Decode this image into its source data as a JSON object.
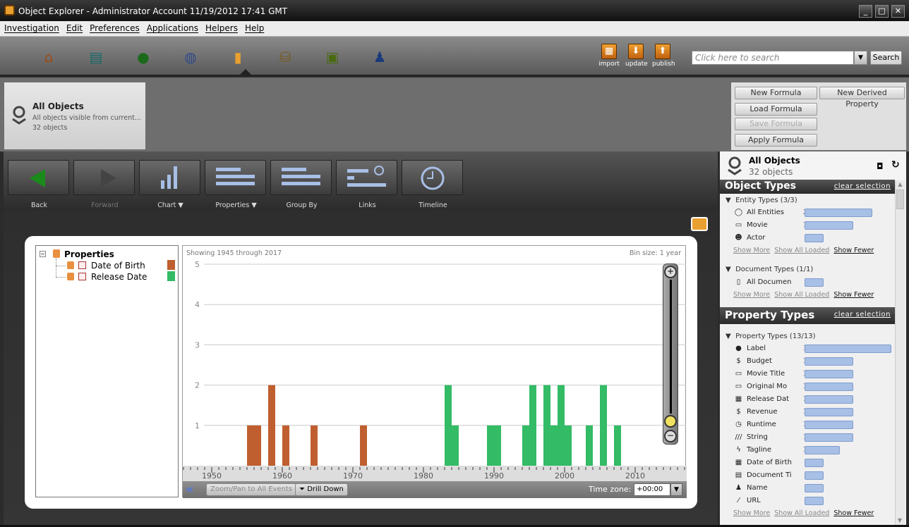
{
  "window": {
    "title": "Object Explorer - Administrator Account 11/19/2012 17:41 GMT",
    "minimize": "_",
    "maximize": "□",
    "close": "✕"
  },
  "menu": [
    "Investigation",
    "Edit",
    "Preferences",
    "Applications",
    "Helpers",
    "Help"
  ],
  "toolbar": {
    "apps": [
      {
        "icon": "home-icon",
        "color": "#a04a10"
      },
      {
        "icon": "document-icon",
        "color": "#1a6a6a"
      },
      {
        "icon": "person-graph-icon",
        "color": "#1a6a1a"
      },
      {
        "icon": "globe-icon",
        "color": "#304a8a"
      },
      {
        "icon": "bar-chart-icon",
        "color": "#e8a030"
      },
      {
        "icon": "database-icon",
        "color": "#7a5a20"
      },
      {
        "icon": "info-folder-icon",
        "color": "#4a6a10"
      },
      {
        "icon": "people-icon",
        "color": "#1a3a7a"
      }
    ],
    "actions": [
      {
        "label": "import",
        "icon": "import-icon"
      },
      {
        "label": "update",
        "icon": "update-icon"
      },
      {
        "label": "publish",
        "icon": "publish-icon"
      }
    ],
    "search_placeholder": "Click here to search",
    "search_button": "Search"
  },
  "selection": {
    "title": "All Objects",
    "description": "All objects visible from current...",
    "count": "32 objects"
  },
  "formula_buttons": {
    "new": "New Formula",
    "new_derived": "New Derived Property",
    "load": "Load Formula",
    "save": "Save Formula",
    "apply": "Apply Formula"
  },
  "tools": [
    {
      "label": "Back",
      "icon": "back-arrow-icon",
      "enabled": true
    },
    {
      "label": "Forward",
      "icon": "forward-arrow-icon",
      "enabled": false
    },
    {
      "label": "Chart ▼",
      "icon": "chart-icon",
      "enabled": true
    },
    {
      "label": "Properties ▼",
      "icon": "properties-icon",
      "enabled": true
    },
    {
      "label": "Group By",
      "icon": "group-by-icon",
      "enabled": true
    },
    {
      "label": "Links",
      "icon": "links-icon",
      "enabled": true
    },
    {
      "label": "Timeline",
      "icon": "timeline-clock-icon",
      "enabled": true
    }
  ],
  "tree": {
    "root": "Properties",
    "items": [
      {
        "label": "Date of Birth",
        "color": "#bf5f30"
      },
      {
        "label": "Release Date",
        "color": "#33bb66"
      }
    ]
  },
  "timeline": {
    "showing": "Showing 1945 through 2017",
    "bin_size": "Bin size: 1 year",
    "zoom_pan_button": "Zoom/Pan to All Events",
    "drill_down_button": "Drill Down",
    "timezone_label": "Time zone:",
    "timezone_value": "+00:00"
  },
  "chart_data": {
    "type": "bar",
    "stacked": false,
    "xlim": [
      1946,
      2017.2
    ],
    "ylim": [
      0,
      5
    ],
    "yticks": [
      1,
      2,
      3,
      4,
      5
    ],
    "xticks": [
      1950,
      1960,
      1970,
      1980,
      1990,
      2000,
      2010
    ],
    "grid": true,
    "series": [
      {
        "name": "Date of Birth",
        "color": "#bf5f30",
        "points": [
          [
            1955,
            1
          ],
          [
            1956,
            1
          ],
          [
            1958,
            2
          ],
          [
            1960,
            1
          ],
          [
            1964,
            1
          ],
          [
            1971,
            1
          ]
        ]
      },
      {
        "name": "Release Date",
        "color": "#33bb66",
        "points": [
          [
            1983,
            2
          ],
          [
            1984,
            1
          ],
          [
            1989,
            1
          ],
          [
            1990,
            1
          ],
          [
            1994,
            1
          ],
          [
            1995,
            2
          ],
          [
            1997,
            2
          ],
          [
            1998,
            1
          ],
          [
            1999,
            2
          ],
          [
            2000,
            1
          ],
          [
            2003,
            1
          ],
          [
            2005,
            2
          ],
          [
            2007,
            1
          ]
        ]
      }
    ]
  },
  "right_panel": {
    "title": "All Objects",
    "count": "32 objects",
    "object_types": {
      "title": "Object Types",
      "clear": "clear selection",
      "groups": [
        {
          "label": "Entity Types (3/3)",
          "items": [
            {
              "icon": "entity-icon",
              "label": "All Entities",
              "count": 25
            },
            {
              "icon": "movie-clapper-icon",
              "label": "Movie",
              "count": 18
            },
            {
              "icon": "actor-icon",
              "label": "Actor",
              "count": 7
            }
          ]
        },
        {
          "label": "Document Types (1/1)",
          "items": [
            {
              "icon": "document-icon",
              "label": "All Documen",
              "count": 7
            }
          ]
        }
      ]
    },
    "property_types": {
      "title": "Property Types",
      "clear": "clear selection",
      "group": "Property Types (13/13)",
      "items": [
        {
          "icon": "label-dot-icon",
          "label": "Label",
          "count": 32
        },
        {
          "icon": "money-icon",
          "label": "Budget",
          "count": 18
        },
        {
          "icon": "movie-clapper-icon",
          "label": "Movie Title",
          "count": 18
        },
        {
          "icon": "movie-clapper-icon",
          "label": "Original Mo",
          "count": 18
        },
        {
          "icon": "calendar-icon",
          "label": "Release Dat",
          "count": 18
        },
        {
          "icon": "money-icon",
          "label": "Revenue",
          "count": 18
        },
        {
          "icon": "clock-icon",
          "label": "Runtime",
          "count": 18
        },
        {
          "icon": "string-icon",
          "label": "String",
          "count": 18
        },
        {
          "icon": "lightning-icon",
          "label": "Tagline",
          "count": 13
        },
        {
          "icon": "calendar-icon",
          "label": "Date of Birth",
          "count": 7
        },
        {
          "icon": "document-title-icon",
          "label": "Document Ti",
          "count": 7
        },
        {
          "icon": "person-icon",
          "label": "Name",
          "count": 7
        },
        {
          "icon": "url-icon",
          "label": "URL",
          "count": 7
        }
      ]
    },
    "show_more": "Show More",
    "show_all_loaded": "Show All Loaded",
    "show_fewer": "Show Fewer"
  }
}
